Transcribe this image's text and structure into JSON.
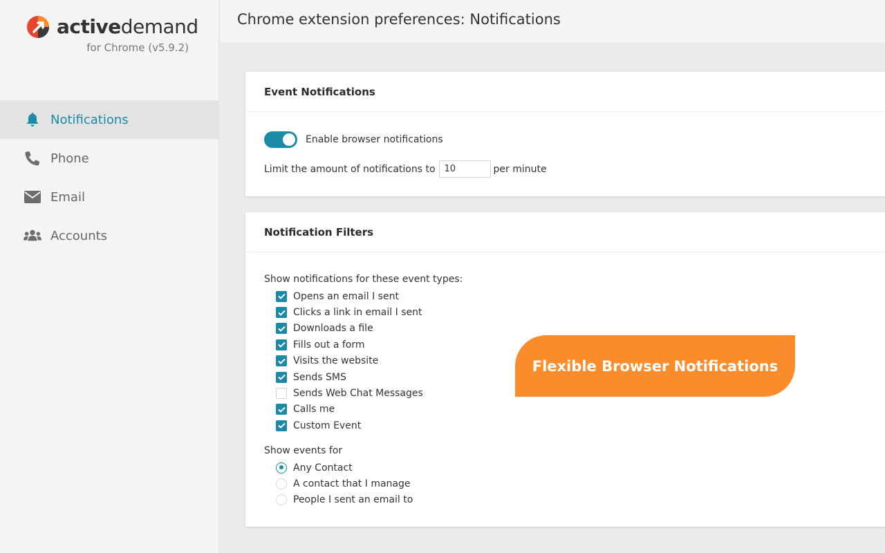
{
  "brand": {
    "name_bold": "active",
    "name_light": "demand",
    "subtitle": "for Chrome (v5.9.2)",
    "colors": {
      "teal": "#1a8aa6",
      "orange": "#fb8c2b",
      "red": "#e8452c",
      "dark": "#3a3a3a"
    }
  },
  "sidebar": {
    "items": [
      {
        "label": "Notifications",
        "icon": "bell-icon",
        "active": true
      },
      {
        "label": "Phone",
        "icon": "phone-icon",
        "active": false
      },
      {
        "label": "Email",
        "icon": "envelope-icon",
        "active": false
      },
      {
        "label": "Accounts",
        "icon": "users-icon",
        "active": false
      }
    ]
  },
  "header": {
    "title": "Chrome extension preferences: Notifications"
  },
  "event_notifications": {
    "title": "Event Notifications",
    "toggle_label": "Enable browser notifications",
    "toggle_on": true,
    "limit_prefix": "Limit the amount of notifications to",
    "limit_value": "10",
    "limit_suffix": "per minute"
  },
  "filters": {
    "title": "Notification Filters",
    "types_label": "Show notifications for these event types:",
    "types": [
      {
        "label": "Opens an email I sent",
        "checked": true
      },
      {
        "label": "Clicks a link in email I sent",
        "checked": true
      },
      {
        "label": "Downloads a file",
        "checked": true
      },
      {
        "label": "Fills out a form",
        "checked": true
      },
      {
        "label": "Visits the website",
        "checked": true
      },
      {
        "label": "Sends SMS",
        "checked": true
      },
      {
        "label": "Sends Web Chat Messages",
        "checked": false
      },
      {
        "label": "Calls me",
        "checked": true
      },
      {
        "label": "Custom Event",
        "checked": true
      }
    ],
    "events_label": "Show events for",
    "events_options": [
      {
        "label": "Any Contact",
        "selected": true
      },
      {
        "label": "A contact that I manage",
        "selected": false
      },
      {
        "label": "People I sent an email to",
        "selected": false
      }
    ]
  },
  "banner": {
    "text": "Flexible Browser Notifications"
  }
}
